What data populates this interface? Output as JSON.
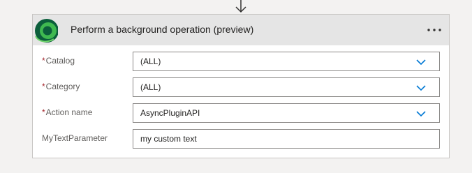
{
  "action": {
    "title": "Perform a background operation (preview)",
    "logo_icon": "dataverse-logo-icon",
    "more_icon": "more-options-icon",
    "colors": {
      "logo_dark": "#0b5e3b",
      "logo_light": "#3fb950",
      "chevron": "#0078d4",
      "required": "#a4262c",
      "header_bg": "#e5e5e5"
    }
  },
  "connector_icon": "arrow-down-icon",
  "fields": [
    {
      "label": "Catalog",
      "required": true,
      "value": "(ALL)",
      "type": "dropdown"
    },
    {
      "label": "Category",
      "required": true,
      "value": "(ALL)",
      "type": "dropdown"
    },
    {
      "label": "Action name",
      "required": true,
      "value": "AsyncPluginAPI",
      "type": "dropdown"
    },
    {
      "label": "MyTextParameter",
      "required": false,
      "value": "my custom text",
      "type": "text"
    }
  ],
  "required_marker": "*"
}
